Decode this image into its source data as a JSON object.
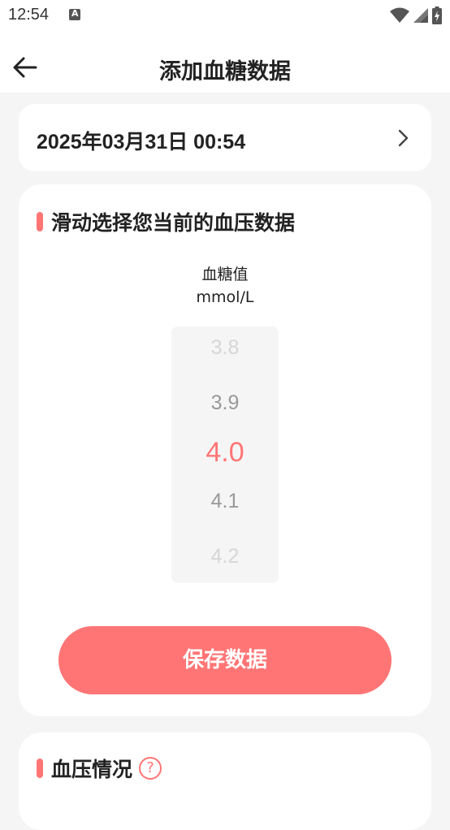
{
  "status_bar": {
    "time": "12:54",
    "icons": [
      "app-notification-icon",
      "wifi-icon",
      "signal-icon",
      "battery-charging-icon"
    ]
  },
  "app_bar": {
    "title": "添加血糖数据",
    "back_icon": "arrow-left-icon"
  },
  "date_card": {
    "datetime": "2025年03月31日 00:54",
    "chevron_icon": "chevron-right-icon"
  },
  "picker_card": {
    "section_title": "滑动选择您当前的血压数据",
    "metric_name": "血糖值",
    "metric_unit": "mmol/L",
    "wheel_values": [
      "3.8",
      "3.9",
      "4.0",
      "4.1",
      "4.2"
    ],
    "selected_value": "4.0",
    "save_label": "保存数据"
  },
  "status_card": {
    "section_title": "血压情况",
    "help_icon_glyph": "?"
  },
  "colors": {
    "accent": "#ff7575",
    "background": "#f5f5f5",
    "card": "#ffffff",
    "text": "#222222",
    "muted": "#999999",
    "faded": "#d6d6d6"
  }
}
